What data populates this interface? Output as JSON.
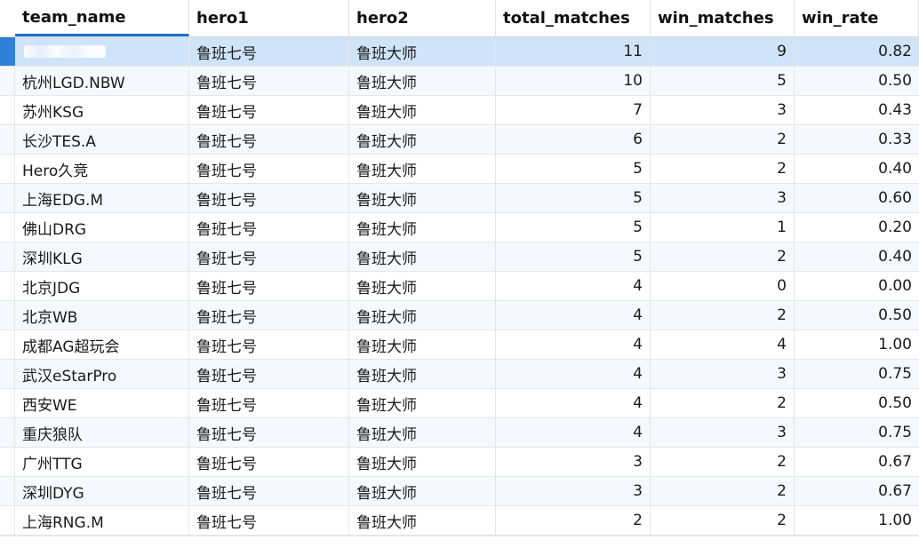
{
  "columns": {
    "team_name": "team_name",
    "hero1": "hero1",
    "hero2": "hero2",
    "total_matches": "total_matches",
    "win_matches": "win_matches",
    "win_rate": "win_rate"
  },
  "rows": [
    {
      "team_name": "",
      "hero1": "鲁班七号",
      "hero2": "鲁班大师",
      "total_matches": "11",
      "win_matches": "9",
      "win_rate": "0.82"
    },
    {
      "team_name": "杭州LGD.NBW",
      "hero1": "鲁班七号",
      "hero2": "鲁班大师",
      "total_matches": "10",
      "win_matches": "5",
      "win_rate": "0.50"
    },
    {
      "team_name": "苏州KSG",
      "hero1": "鲁班七号",
      "hero2": "鲁班大师",
      "total_matches": "7",
      "win_matches": "3",
      "win_rate": "0.43"
    },
    {
      "team_name": "长沙TES.A",
      "hero1": "鲁班七号",
      "hero2": "鲁班大师",
      "total_matches": "6",
      "win_matches": "2",
      "win_rate": "0.33"
    },
    {
      "team_name": "Hero久竞",
      "hero1": "鲁班七号",
      "hero2": "鲁班大师",
      "total_matches": "5",
      "win_matches": "2",
      "win_rate": "0.40"
    },
    {
      "team_name": "上海EDG.M",
      "hero1": "鲁班七号",
      "hero2": "鲁班大师",
      "total_matches": "5",
      "win_matches": "3",
      "win_rate": "0.60"
    },
    {
      "team_name": "佛山DRG",
      "hero1": "鲁班七号",
      "hero2": "鲁班大师",
      "total_matches": "5",
      "win_matches": "1",
      "win_rate": "0.20"
    },
    {
      "team_name": "深圳KLG",
      "hero1": "鲁班七号",
      "hero2": "鲁班大师",
      "total_matches": "5",
      "win_matches": "2",
      "win_rate": "0.40"
    },
    {
      "team_name": "北京JDG",
      "hero1": "鲁班七号",
      "hero2": "鲁班大师",
      "total_matches": "4",
      "win_matches": "0",
      "win_rate": "0.00"
    },
    {
      "team_name": "北京WB",
      "hero1": "鲁班七号",
      "hero2": "鲁班大师",
      "total_matches": "4",
      "win_matches": "2",
      "win_rate": "0.50"
    },
    {
      "team_name": "成都AG超玩会",
      "hero1": "鲁班七号",
      "hero2": "鲁班大师",
      "total_matches": "4",
      "win_matches": "4",
      "win_rate": "1.00"
    },
    {
      "team_name": "武汉eStarPro",
      "hero1": "鲁班七号",
      "hero2": "鲁班大师",
      "total_matches": "4",
      "win_matches": "3",
      "win_rate": "0.75"
    },
    {
      "team_name": "西安WE",
      "hero1": "鲁班七号",
      "hero2": "鲁班大师",
      "total_matches": "4",
      "win_matches": "2",
      "win_rate": "0.50"
    },
    {
      "team_name": "重庆狼队",
      "hero1": "鲁班七号",
      "hero2": "鲁班大师",
      "total_matches": "4",
      "win_matches": "3",
      "win_rate": "0.75"
    },
    {
      "team_name": "广州TTG",
      "hero1": "鲁班七号",
      "hero2": "鲁班大师",
      "total_matches": "3",
      "win_matches": "2",
      "win_rate": "0.67"
    },
    {
      "team_name": "深圳DYG",
      "hero1": "鲁班七号",
      "hero2": "鲁班大师",
      "total_matches": "3",
      "win_matches": "2",
      "win_rate": "0.67"
    },
    {
      "team_name": "上海RNG.M",
      "hero1": "鲁班七号",
      "hero2": "鲁班大师",
      "total_matches": "2",
      "win_matches": "2",
      "win_rate": "1.00"
    }
  ],
  "selected_row_index": 0,
  "colors": {
    "accent": "#1f6fc5",
    "selected_row": "#cfe4f8",
    "alt_row": "#f5f9fd",
    "grid_line": "#e6e6e6"
  }
}
